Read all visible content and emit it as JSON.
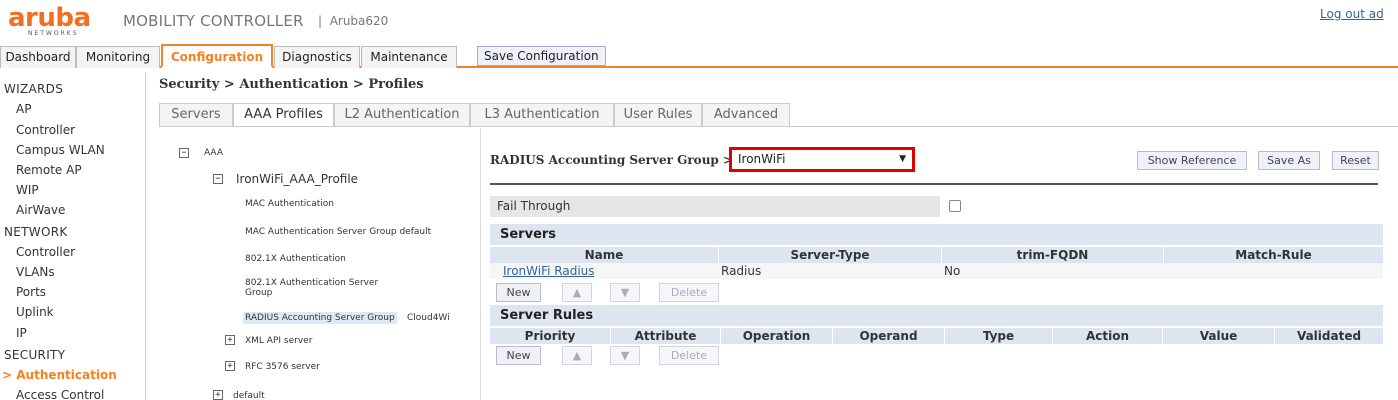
{
  "brand": {
    "logo_text": "aruba",
    "logo_sub": "NETWORKS",
    "product": "MOBILITY CONTROLLER",
    "separator": "|",
    "device": "Aruba620",
    "logout": "Log out ad"
  },
  "topnav": {
    "tabs": [
      "Dashboard",
      "Monitoring",
      "Configuration",
      "Diagnostics",
      "Maintenance"
    ],
    "active": "Configuration",
    "save_button": "Save Configuration"
  },
  "sidebar": {
    "sections": [
      {
        "title": "WIZARDS",
        "items": [
          "AP",
          "Controller",
          "Campus WLAN",
          "Remote AP",
          "WIP",
          "AirWave"
        ]
      },
      {
        "title": "NETWORK",
        "items": [
          "Controller",
          "VLANs",
          "Ports",
          "Uplink",
          "IP"
        ]
      },
      {
        "title": "SECURITY",
        "items": [
          "Authentication",
          "Access Control"
        ]
      }
    ],
    "active_marker": ">",
    "active_item": "Authentication"
  },
  "page_title": "Security > Authentication > Profiles",
  "subtabs": [
    "Servers",
    "AAA Profiles",
    "L2 Authentication",
    "L3 Authentication",
    "User Rules",
    "Advanced"
  ],
  "active_subtab": "AAA Profiles",
  "tree": {
    "root_expander": "−",
    "child_expander": "+",
    "root": "AAA",
    "profile": "IronWiFi_AAA_Profile",
    "items": [
      "MAC Authentication",
      "MAC Authentication Server Group  default",
      "802.1X Authentication",
      "802.1X Authentication Server",
      "Group",
      "RADIUS Accounting Server Group",
      "Cloud4Wi"
    ],
    "sub_nodes": [
      "XML API server",
      "RFC 3576 server"
    ],
    "default_node": "default"
  },
  "detail": {
    "title": "RADIUS Accounting Server Group >",
    "selected_group": "IronWiFi",
    "caret": "▼",
    "buttons": {
      "show_reference": "Show Reference",
      "save_as": "Save As",
      "reset": "Reset"
    },
    "fail_through_label": "Fail Through",
    "fail_through_checked": false,
    "servers": {
      "header": "Servers",
      "columns": [
        "Name",
        "Server-Type",
        "trim-FQDN",
        "Match-Rule"
      ],
      "rows": [
        {
          "name": "IronWiFi Radius",
          "server_type": "Radius",
          "trim_fqdn": "No",
          "match_rule": ""
        }
      ]
    },
    "server_rules": {
      "header": "Server Rules",
      "columns": [
        "Priority",
        "Attribute",
        "Operation",
        "Operand",
        "Type",
        "Action",
        "Value",
        "Validated"
      ]
    },
    "row_buttons": {
      "new": "New",
      "up": "▲",
      "down": "▼",
      "delete": "Delete"
    }
  }
}
